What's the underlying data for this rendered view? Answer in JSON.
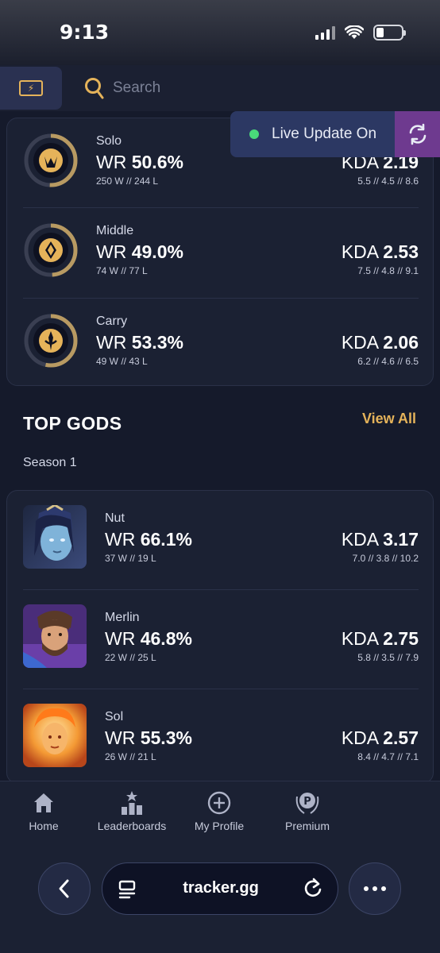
{
  "status_bar": {
    "time": "9:13"
  },
  "header": {
    "search_placeholder": "Search"
  },
  "live_update": {
    "label": "Live Update On",
    "dot_color": "#49d97a"
  },
  "roles": [
    {
      "name": "Solo",
      "wr_label": "WR",
      "wr": "50.6%",
      "wl": "250 W // 244 L",
      "kda_label": "KDA",
      "kda": "2.19",
      "kda_detail": "5.5 // 4.5 // 8.6",
      "icon": "solo-role-icon",
      "wr_fraction": 0.506
    },
    {
      "name": "Middle",
      "wr_label": "WR",
      "wr": "49.0%",
      "wl": "74 W // 77 L",
      "kda_label": "KDA",
      "kda": "2.53",
      "kda_detail": "7.5 // 4.8 // 9.1",
      "icon": "middle-role-icon",
      "wr_fraction": 0.49
    },
    {
      "name": "Carry",
      "wr_label": "WR",
      "wr": "53.3%",
      "wl": "49 W // 43 L",
      "kda_label": "KDA",
      "kda": "2.06",
      "kda_detail": "6.2 // 4.6 // 6.5",
      "icon": "carry-role-icon",
      "wr_fraction": 0.533
    }
  ],
  "top_gods": {
    "title": "TOP GODS",
    "view_all": "View All",
    "season": "Season 1",
    "items": [
      {
        "name": "Nut",
        "wr_label": "WR",
        "wr": "66.1%",
        "wl": "37 W // 19 L",
        "kda_label": "KDA",
        "kda": "3.17",
        "kda_detail": "7.0 // 3.8 // 10.2",
        "icon": "nut-portrait"
      },
      {
        "name": "Merlin",
        "wr_label": "WR",
        "wr": "46.8%",
        "wl": "22 W // 25 L",
        "kda_label": "KDA",
        "kda": "2.75",
        "kda_detail": "5.8 // 3.5 // 7.9",
        "icon": "merlin-portrait"
      },
      {
        "name": "Sol",
        "wr_label": "WR",
        "wr": "55.3%",
        "wl": "26 W // 21 L",
        "kda_label": "KDA",
        "kda": "2.57",
        "kda_detail": "8.4 // 4.7 // 7.1",
        "icon": "sol-portrait"
      }
    ]
  },
  "bottom_nav": [
    {
      "label": "Home",
      "icon": "home-icon"
    },
    {
      "label": "Leaderboards",
      "icon": "leaderboards-icon"
    },
    {
      "label": "My Profile",
      "icon": "add-profile-icon"
    },
    {
      "label": "Premium",
      "icon": "premium-icon"
    }
  ],
  "browser": {
    "url": "tracker.gg"
  },
  "colors": {
    "accent": "#e5b35a",
    "background": "#151a2b",
    "card": "#1b2133",
    "live_pill": "#2c3863",
    "refresh": "#6e3a8f"
  }
}
